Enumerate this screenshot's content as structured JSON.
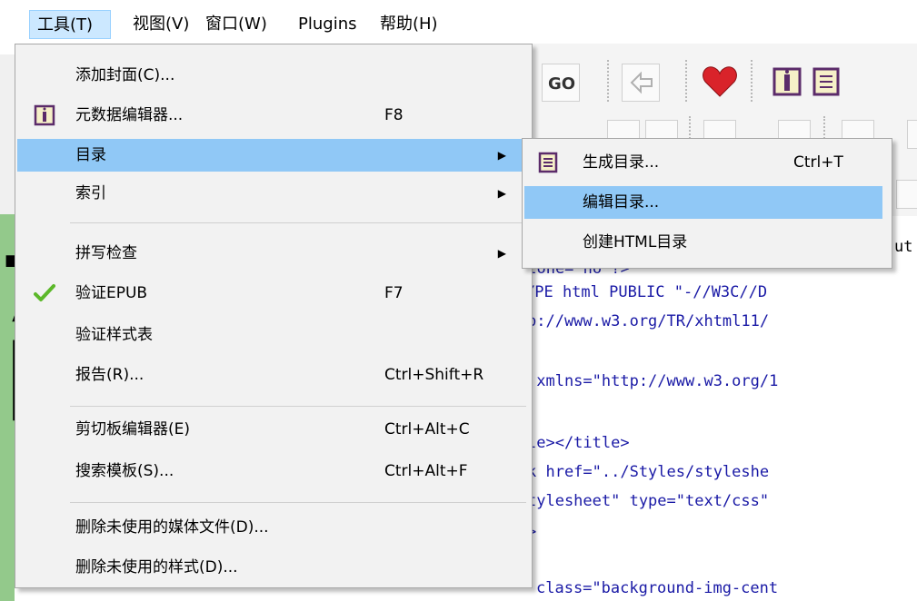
{
  "menubar": {
    "items": [
      {
        "label": "工具(T)",
        "active": true
      },
      {
        "label": "视图(V)",
        "active": false
      },
      {
        "label": "窗口(W)",
        "active": false
      },
      {
        "label": "Plugins",
        "active": false
      },
      {
        "label": "帮助(H)",
        "active": false
      }
    ]
  },
  "tools_menu": {
    "items": [
      {
        "label": "添加封面(C)...",
        "shortcut": ""
      },
      {
        "label": "元数据编辑器...",
        "shortcut": "F8",
        "icon": "metadata-book-icon"
      },
      {
        "label": "目录",
        "submenu": true,
        "highlighted": true
      },
      {
        "label": "索引",
        "submenu": true
      },
      {
        "label": "拼写检查",
        "submenu": true
      },
      {
        "label": "验证EPUB",
        "shortcut": "F7",
        "icon": "green-checkmark-icon"
      },
      {
        "label": "验证样式表",
        "shortcut": ""
      },
      {
        "label": "报告(R)...",
        "shortcut": "Ctrl+Shift+R"
      },
      {
        "label": "剪切板编辑器(E)",
        "shortcut": "Ctrl+Alt+C"
      },
      {
        "label": "搜索模板(S)...",
        "shortcut": "Ctrl+Alt+F"
      },
      {
        "label": "删除未使用的媒体文件(D)...",
        "shortcut": ""
      },
      {
        "label": "删除未使用的样式(D)...",
        "shortcut": ""
      }
    ]
  },
  "toc_submenu": {
    "items": [
      {
        "label": "生成目录...",
        "shortcut": "Ctrl+T",
        "icon": "toc-list-icon"
      },
      {
        "label": "编辑目录...",
        "shortcut": "",
        "highlighted": true
      },
      {
        "label": "创建HTML目录",
        "shortcut": ""
      }
    ]
  },
  "code_editor": {
    "lines": [
      "ut",
      "alone=\"no\"?>",
      "YPE html PUBLIC \"-//W3C//D",
      "p://www.w3.org/TR/xhtml11/",
      "",
      " xmlns=\"http://www.w3.org/1",
      "",
      "le></title>",
      "k href=\"../Styles/styleshe",
      "tylesheet\" type=\"text/css\"",
      ">",
      "",
      "class=\"background-img-cent"
    ]
  },
  "colors": {
    "menu_highlight": "#90c8f6",
    "menubar_active": "#cce8ff",
    "green_panel": "#93c98b"
  }
}
